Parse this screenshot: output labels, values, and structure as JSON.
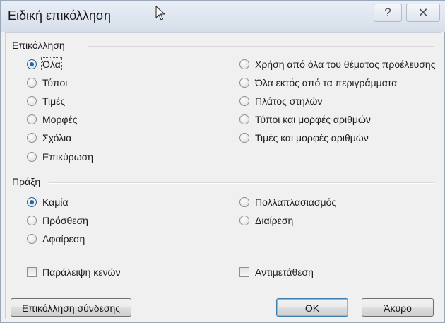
{
  "window": {
    "title": "Ειδική επικόλληση",
    "help_glyph": "?",
    "close_glyph": "✕"
  },
  "paste_group": {
    "title": "Επικόλληση",
    "options_left": [
      {
        "label": "Όλα",
        "checked": true
      },
      {
        "label": "Τύποι",
        "checked": false
      },
      {
        "label": "Τιμές",
        "checked": false
      },
      {
        "label": "Μορφές",
        "checked": false
      },
      {
        "label": "Σχόλια",
        "checked": false
      },
      {
        "label": "Επικύρωση",
        "checked": false
      }
    ],
    "options_right": [
      {
        "label": "Χρήση από όλα του θέματος προέλευσης",
        "checked": false
      },
      {
        "label": "Όλα εκτός από τα περιγράμματα",
        "checked": false
      },
      {
        "label": "Πλάτος στηλών",
        "checked": false
      },
      {
        "label": "Τύποι και μορφές αριθμών",
        "checked": false
      },
      {
        "label": "Τιμές και μορφές αριθμών",
        "checked": false
      }
    ]
  },
  "operation_group": {
    "title": "Πράξη",
    "options_left": [
      {
        "label": "Καμία",
        "checked": true
      },
      {
        "label": "Πρόσθεση",
        "checked": false
      },
      {
        "label": "Αφαίρεση",
        "checked": false
      }
    ],
    "options_right": [
      {
        "label": "Πολλαπλασιασμός",
        "checked": false
      },
      {
        "label": "Διαίρεση",
        "checked": false
      }
    ]
  },
  "checkboxes": {
    "skip_blanks": {
      "label": "Παράλειψη κενών",
      "checked": false
    },
    "transpose": {
      "label": "Αντιμετάθεση",
      "checked": false
    }
  },
  "buttons": {
    "paste_link": "Επικόλληση σύνδεσης",
    "ok": "OK",
    "cancel": "Άκυρο"
  }
}
